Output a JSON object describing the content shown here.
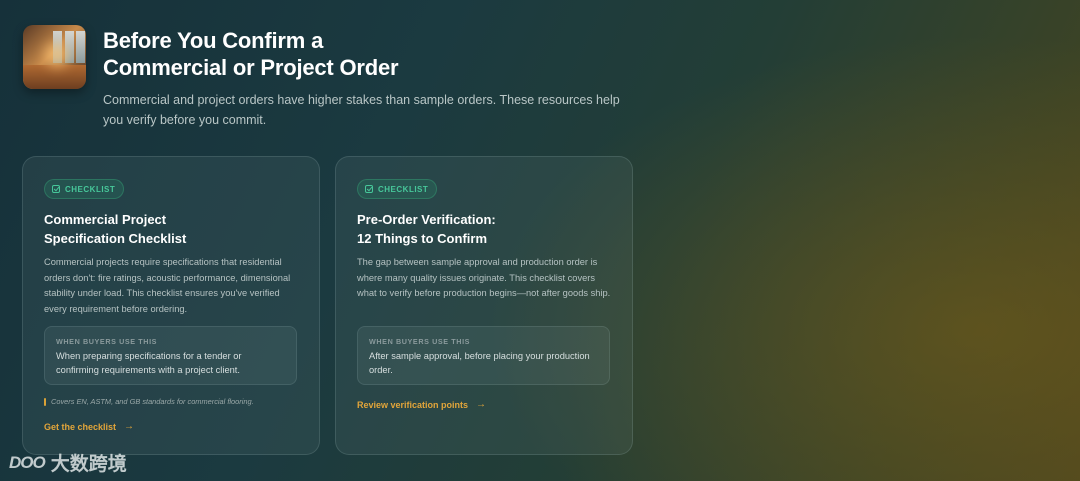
{
  "header": {
    "title_line1": "Before You Confirm a",
    "title_line2": "Commercial or Project Order",
    "intro_line1": "Commercial and project orders have higher stakes than sample orders. These resources help",
    "intro_line2": "you verify before you commit."
  },
  "cards": [
    {
      "badge": "CHECKLIST",
      "title_line1": "Commercial Project",
      "title_line2": "Specification Checklist",
      "description": "Commercial projects require specifications that residential orders don't: fire ratings, acoustic performance, dimensional stability under load. This checklist ensures you've verified every requirement before ordering.",
      "use_label": "WHEN BUYERS USE THIS",
      "use_text": "When preparing specifications for a tender or confirming requirements with a project client.",
      "note": "Covers EN, ASTM, and GB standards for commercial flooring.",
      "cta": "Get the checklist",
      "cta_arrow": "→"
    },
    {
      "badge": "CHECKLIST",
      "title_line1": "Pre-Order Verification:",
      "title_line2": "12 Things to Confirm",
      "description": "The gap between sample approval and production order is where many quality issues originate. This checklist covers what to verify before production begins—not after goods ship.",
      "use_label": "WHEN BUYERS USE THIS",
      "use_text": "After sample approval, before placing your production order.",
      "cta": "Review verification points",
      "cta_arrow": "→"
    }
  ],
  "watermark": {
    "logo": "DOO",
    "text": "大数跨境"
  },
  "colors": {
    "accent_orange": "#e2a53a",
    "badge_green": "#47c79a"
  }
}
